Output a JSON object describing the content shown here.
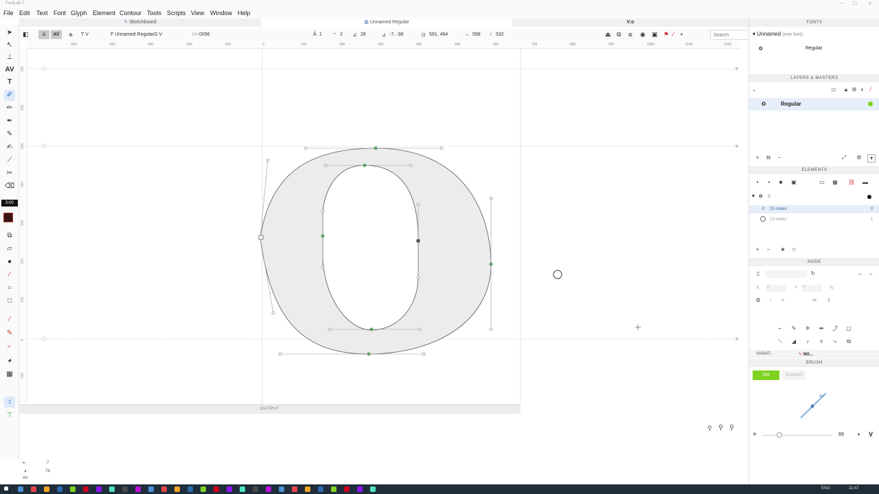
{
  "app": {
    "title": "FontLab 7"
  },
  "menu": [
    "File",
    "Edit",
    "Text",
    "Font",
    "Glyph",
    "Element",
    "Contour",
    "Tools",
    "Scripts",
    "View",
    "Window",
    "Help"
  ],
  "tabs": [
    {
      "label": "Sketchboard",
      "active": false
    },
    {
      "label": "Unnamed Regular",
      "active": true
    }
  ],
  "window_label": "V:o",
  "propbar": {
    "view_label": "T V",
    "font_label": "F Unnamed Regular",
    "glyph_label": "G V",
    "unicode_label": "U+",
    "unicode_value": "0056",
    "nodes_label": "1",
    "handles_label": "2",
    "angle_label": "28",
    "delta_label": "-7, -38",
    "position_label": "591, 494",
    "width_label": "598",
    "height_label": "532",
    "search_placeholder": "Search"
  },
  "ruler": {
    "ticks": [
      "-500",
      "-400",
      "-300",
      "-200",
      "-100",
      "0",
      "100",
      "200",
      "300",
      "400",
      "500",
      "600",
      "700",
      "800",
      "900",
      "1000",
      "1100",
      "1200"
    ]
  },
  "vruler": {
    "ticks": [
      "700",
      "600",
      "500",
      "400",
      "300",
      "200",
      "100",
      "0",
      "-100"
    ]
  },
  "tool_badge": "5:00",
  "output": {
    "title": "OUTPUT"
  },
  "status": {
    "x": "-7",
    "y": "76"
  },
  "panels": {
    "fonts": {
      "header": "FONTS",
      "font_name": "Unnamed",
      "font_count": "(one font)",
      "master": "Regular"
    },
    "layers": {
      "header": "LAYERS & MASTERS",
      "layer_name": "Regular"
    },
    "elements": {
      "header": "ELEMENTS",
      "element_name": "2",
      "rows": [
        {
          "label": "15 nodes",
          "index": "0"
        },
        {
          "label": "13 nodes",
          "index": "1"
        }
      ]
    },
    "node": {
      "header": "NODE",
      "x_label": "X",
      "x_value": "0",
      "y_label": "Y",
      "y_value": "0"
    },
    "tabs": [
      "VARIAT...",
      "NO..."
    ],
    "brush": {
      "header": "BRUSH",
      "set_label": "Set",
      "expand_label": "Expand",
      "angle_label": "40°",
      "zoom_value": "69"
    }
  },
  "taskbar": {
    "lang": "ENG",
    "time": "11:47"
  },
  "colors": {
    "accent_green": "#7ed321",
    "selection_blue": "#1b67c4",
    "node_green": "#5fa06a",
    "glyph_fill": "#ececec"
  }
}
